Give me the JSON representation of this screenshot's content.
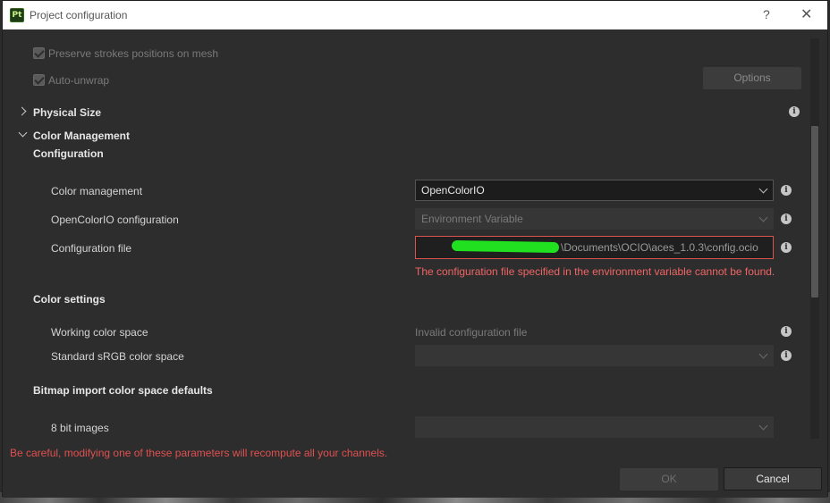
{
  "window": {
    "title": "Project configuration",
    "logo_text": "Pt",
    "help_glyph": "?",
    "close_glyph": "✕"
  },
  "options_section": {
    "preserve_strokes": {
      "label": "Preserve strokes positions on mesh",
      "checked": true,
      "disabled": true
    },
    "auto_unwrap": {
      "label": "Auto-unwrap",
      "checked": true,
      "disabled": true
    },
    "options_button": "Options"
  },
  "physical_size": {
    "title": "Physical Size",
    "expanded": false
  },
  "color_management": {
    "title": "Color Management",
    "expanded": true,
    "configuration": {
      "heading": "Configuration",
      "color_management": {
        "label": "Color management",
        "value": "OpenColorIO"
      },
      "ocio_configuration": {
        "label": "OpenColorIO configuration",
        "value": "Environment Variable"
      },
      "configuration_file": {
        "label": "Configuration file",
        "value": "\\Documents\\OCIO\\aces_1.0.3\\config.ocio",
        "error": "The configuration file specified in the environment variable cannot be found."
      }
    },
    "color_settings": {
      "heading": "Color settings",
      "working_color_space": {
        "label": "Working color space",
        "value": "Invalid configuration file"
      },
      "standard_srgb": {
        "label": "Standard sRGB color space",
        "value": ""
      }
    },
    "bitmap_import": {
      "heading": "Bitmap import color space defaults",
      "eight_bit": {
        "label": "8 bit images",
        "value": ""
      }
    }
  },
  "footer": {
    "warning": "Be careful, modifying one of these parameters will recompute all your channels.",
    "ok_button": "OK",
    "cancel_button": "Cancel"
  },
  "colors": {
    "error": "#f06565",
    "accent_logo": "#c9f28a",
    "redaction": "#20e020"
  },
  "icons": [
    "info-icon",
    "chevron-right-icon",
    "chevron-down-icon",
    "checkbox-checked-icon",
    "help-icon",
    "close-icon"
  ]
}
